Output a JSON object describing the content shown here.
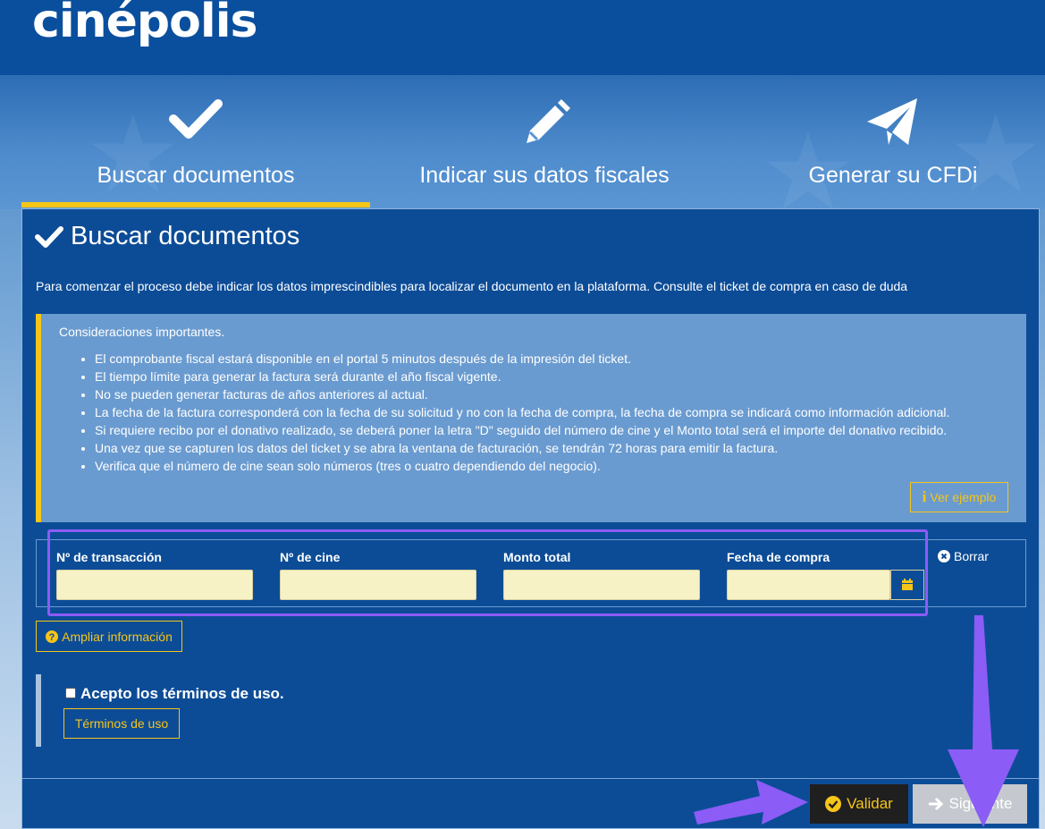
{
  "brand": {
    "logo_text": "cinépolis"
  },
  "steps": [
    {
      "label": "Buscar documentos",
      "icon": "check-icon"
    },
    {
      "label": "Indicar sus datos fiscales",
      "icon": "pencil-icon"
    },
    {
      "label": "Generar su CFDi",
      "icon": "paper-plane-icon"
    }
  ],
  "panel": {
    "title": "Buscar documentos",
    "intro": "Para comenzar el proceso debe indicar los datos imprescindibles para localizar el documento en la plataforma. Consulte el ticket de compra en caso de duda",
    "notice": {
      "title": "Consideraciones importantes.",
      "items": [
        "El comprobante fiscal estará disponible en el portal 5 minutos después de la impresión del ticket.",
        "El tiempo límite para generar la factura será durante el año fiscal vigente.",
        "No se pueden generar facturas de años anteriores al actual.",
        "La fecha de la factura corresponderá con la fecha de su solicitud y no con la fecha de compra, la fecha de compra se indicará como información adicional.",
        "Si requiere recibo por el donativo realizado, se deberá poner la letra \"D\" seguido del número de cine y el Monto total será el importe del donativo recibido.",
        "Una vez que se capturen los datos del ticket y se abra la ventana de facturación, se tendrán 72 horas para emitir la factura.",
        "Verifica que el número de cine sean solo números (tres o cuatro dependiendo del negocio)."
      ],
      "example_button": "Ver ejemplo"
    },
    "form": {
      "transaccion_label": "Nº de transacción",
      "transaccion_value": "",
      "cine_label": "Nº de cine",
      "cine_value": "",
      "monto_label": "Monto total",
      "monto_value": "",
      "fecha_label": "Fecha de compra",
      "fecha_value": "",
      "borrar_label": "Borrar"
    },
    "more_info_button": "Ampliar información",
    "terms": {
      "checkbox_label": "Acepto los términos de uso.",
      "checked": false,
      "terms_button": "Términos de uso"
    },
    "actions": {
      "validar": "Validar",
      "siguiente": "Siguiente"
    }
  },
  "colors": {
    "accent": "#f5c518",
    "panel": "#0c4c97",
    "annotation": "#8b5cf6"
  }
}
